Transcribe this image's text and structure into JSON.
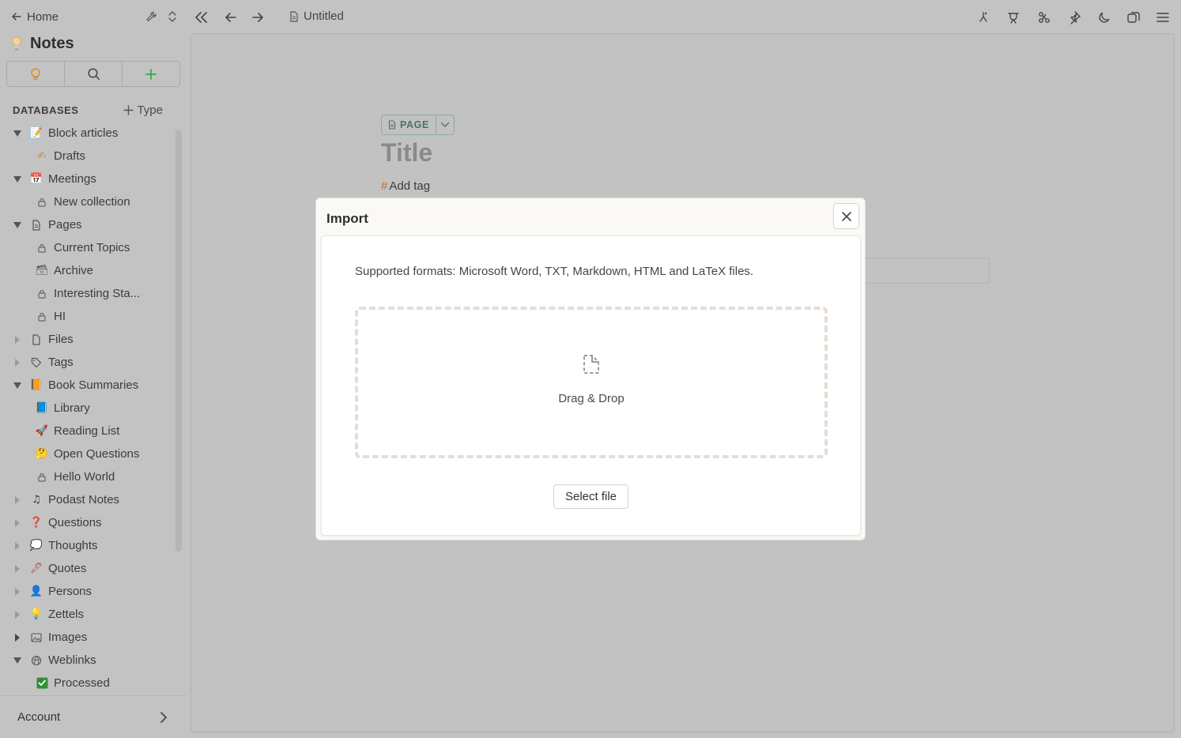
{
  "sidebar": {
    "home_label": "Home",
    "notes_title": "Notes",
    "databases_label": "DATABASES",
    "type_label": "Type",
    "items": [
      {
        "label": "Block articles",
        "icon": "memo-icon",
        "glyph": "📝",
        "level": 0,
        "state": "expanded"
      },
      {
        "label": "Drafts",
        "icon": "writing-hand-icon",
        "glyph": "✍",
        "level": 1,
        "state": "none"
      },
      {
        "label": "Meetings",
        "icon": "calendar-icon",
        "glyph": "📅",
        "level": 0,
        "state": "expanded"
      },
      {
        "label": "New collection",
        "icon": "lock-icon",
        "glyph": "",
        "level": 1,
        "state": "none"
      },
      {
        "label": "Pages",
        "icon": "page-icon",
        "glyph": "",
        "level": 0,
        "state": "expanded"
      },
      {
        "label": "Current Topics",
        "icon": "lock-icon",
        "glyph": "",
        "level": 1,
        "state": "none"
      },
      {
        "label": "Archive",
        "icon": "archive-box-icon",
        "glyph": "🗃",
        "level": 1,
        "state": "none"
      },
      {
        "label": "Interesting Sta...",
        "icon": "lock-icon",
        "glyph": "",
        "level": 1,
        "state": "none"
      },
      {
        "label": "HI",
        "icon": "lock-icon",
        "glyph": "",
        "level": 1,
        "state": "none"
      },
      {
        "label": "Files",
        "icon": "file-icon",
        "glyph": "",
        "level": 0,
        "state": "collapsed"
      },
      {
        "label": "Tags",
        "icon": "tag-icon",
        "glyph": "",
        "level": 0,
        "state": "collapsed"
      },
      {
        "label": "Book Summaries",
        "icon": "book-icon",
        "glyph": "📙",
        "level": 0,
        "state": "expanded"
      },
      {
        "label": "Library",
        "icon": "book-stack-icon",
        "glyph": "📘",
        "level": 1,
        "state": "none"
      },
      {
        "label": "Reading List",
        "icon": "rocket-icon",
        "glyph": "🚀",
        "level": 1,
        "state": "none"
      },
      {
        "label": "Open Questions",
        "icon": "thinking-face-icon",
        "glyph": "🤔",
        "level": 1,
        "state": "none"
      },
      {
        "label": "Hello World",
        "icon": "lock-icon",
        "glyph": "",
        "level": 1,
        "state": "none"
      },
      {
        "label": "Podast Notes",
        "icon": "music-note-icon",
        "glyph": "♫",
        "level": 0,
        "state": "collapsed"
      },
      {
        "label": "Questions",
        "icon": "question-mark-icon",
        "glyph": "❓",
        "level": 0,
        "state": "collapsed"
      },
      {
        "label": "Thoughts",
        "icon": "speech-bubble-icon",
        "glyph": "💭",
        "level": 0,
        "state": "collapsed"
      },
      {
        "label": "Quotes",
        "icon": "quill-icon",
        "glyph": "🖋",
        "level": 0,
        "state": "collapsed"
      },
      {
        "label": "Persons",
        "icon": "person-icon",
        "glyph": "👤",
        "level": 0,
        "state": "collapsed"
      },
      {
        "label": "Zettels",
        "icon": "lightbulb-icon",
        "glyph": "💡",
        "level": 0,
        "state": "collapsed"
      },
      {
        "label": "Images",
        "icon": "image-icon",
        "glyph": "",
        "level": 0,
        "state": "collapsed-dark"
      },
      {
        "label": "Weblinks",
        "icon": "globe-icon",
        "glyph": "",
        "level": 0,
        "state": "expanded"
      },
      {
        "label": "Processed",
        "icon": "check-box-icon",
        "glyph": "✓",
        "level": 1,
        "state": "none"
      }
    ],
    "account_label": "Account"
  },
  "topbar": {
    "tab_title": "Untitled"
  },
  "editor": {
    "page_type_label": "PAGE",
    "title_placeholder": "Title",
    "add_tag_hash": "#",
    "add_tag_label": "Add tag"
  },
  "modal": {
    "title": "Import",
    "formats_text": "Supported formats: Microsoft Word, TXT, Markdown, HTML and LaTeX files.",
    "dropzone_label": "Drag & Drop",
    "select_file_label": "Select file"
  },
  "colors": {
    "overlay_bg": "#c3c3c3",
    "accent_green": "#3aa54a",
    "accent_orange": "#d8902a",
    "page_chip": "#4c7069",
    "modal_bg": "#fbf9f6",
    "dropzone_border": "#e7ddd3"
  }
}
